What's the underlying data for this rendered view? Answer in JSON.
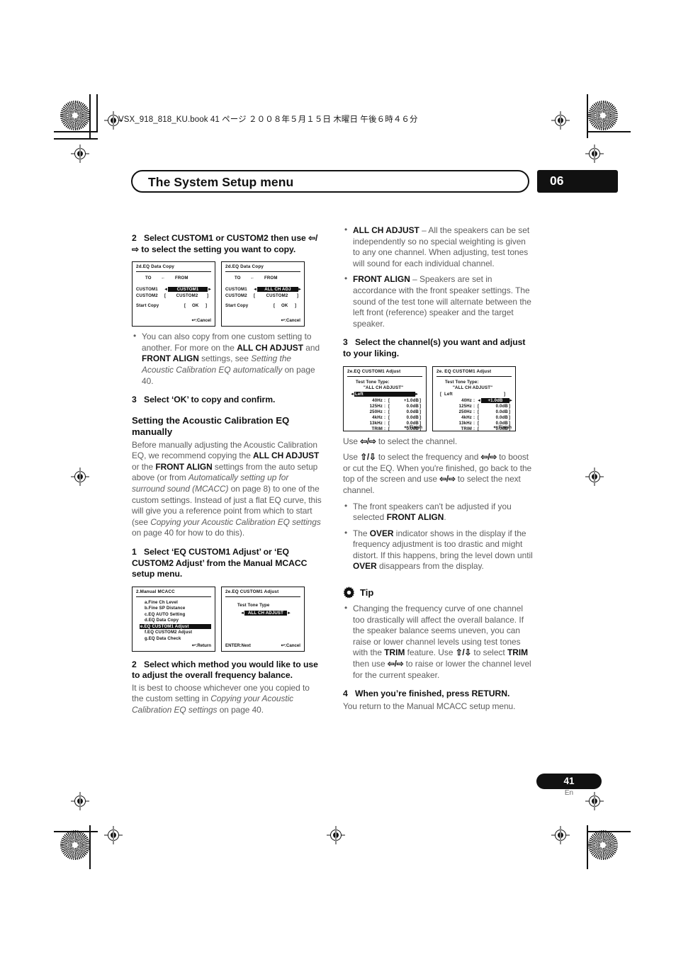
{
  "print": {
    "file_line": "VSX_918_818_KU.book  41 ページ  ２００８年５月１５日  木曜日  午後６時４６分"
  },
  "header": {
    "title": "The System Setup menu",
    "chapter": "06"
  },
  "footer": {
    "page_number": "41",
    "language": "En"
  },
  "left_column": {
    "step2": {
      "num": "2",
      "text_part1": "Select CUSTOM1 or CUSTOM2 then use ",
      "arrows": "⇦/⇨",
      "text_part2": " to select the setting you want to copy."
    },
    "screens": [
      {
        "title": "2d.EQ  Data  Copy",
        "header_to": "TO",
        "header_arrow": "←",
        "header_from": "FROM",
        "row1_label": "CUSTOM1",
        "row1_left_caret": "◄",
        "row1_value": "CUSTOM1",
        "row1_right_caret": "►",
        "row1_highlighted": true,
        "row2_label": "CUSTOM2",
        "row2_open": "[",
        "row2_value": "CUSTOM2",
        "row2_close": "]",
        "start_label": "Start  Copy",
        "start_open": "[",
        "start_value": "OK",
        "start_close": "]",
        "foot": ":Cancel"
      },
      {
        "title": "2d.EQ  Data  Copy",
        "header_to": "TO",
        "header_arrow": "←",
        "header_from": "FROM",
        "row1_label": "CUSTOM1",
        "row1_left_caret": "◄",
        "row1_value": "ALL  CH  ADJ",
        "row1_right_caret": "►",
        "row1_highlighted": true,
        "row2_label": "CUSTOM2",
        "row2_open": "[",
        "row2_value": "CUSTOM2",
        "row2_close": "]",
        "start_label": "Start  Copy",
        "start_open": "[",
        "start_value": "OK",
        "start_close": "]",
        "foot": ":Cancel"
      }
    ],
    "bullet_copy": {
      "p1": "You can also copy from one custom setting to another. For more on the ",
      "b1": "ALL CH ADJUST",
      "p2": " and ",
      "b2": "FRONT ALIGN",
      "p3": " settings, see ",
      "i1": "Setting the Acoustic Calibration EQ automatically",
      "p4": " on page 40."
    },
    "step3": {
      "num": "3",
      "text": "Select ‘OK’ to copy and confirm."
    },
    "heading_manual": "Setting the Acoustic Calibration EQ manually",
    "manual_para": {
      "p1": "Before manually adjusting the Acoustic Calibration EQ, we recommend copying the ",
      "b1": "ALL CH ADJUST",
      "p2": " or the ",
      "b2": "FRONT ALIGN",
      "p3": " settings from the auto setup above (or from ",
      "i1": "Automatically setting up for surround sound (MCACC)",
      "p4": " on page 8) to one of the custom settings. Instead of just a flat EQ curve, this will give you a reference point from which to start (see ",
      "i2": "Copying your Acoustic Calibration EQ settings",
      "p5": " on page 40 for how to do this)."
    },
    "step1": {
      "num": "1",
      "text": "Select ‘EQ CUSTOM1 Adjust’ or ‘EQ CUSTOM2 Adjust’ from the Manual MCACC setup menu."
    },
    "menu_screens": [
      {
        "title": "2.Manual  MCACC",
        "items": [
          "a.Fine  Ch  Level",
          "b.Fine  SP  Distance",
          "c.EQ  AUTO  Setting",
          "d.EQ  Data  Copy",
          "e.EQ  CUSTOM1  Adjust",
          "f.EQ  CUSTOM2  Adjust",
          "g.EQ  Data  Check"
        ],
        "highlighted_index": 4,
        "foot": ":Return"
      },
      {
        "title": "2e.EQ  CUSTOM1  Adjust",
        "subtitle": "Test  Tone  Type",
        "left_caret": "◄",
        "value": "ALL  CH  ADJUST",
        "right_caret": "►",
        "foot_left": "ENTER:Next",
        "foot": ":Cancel"
      }
    ],
    "step2b": {
      "num": "2",
      "text": "Select which method you would like to use to adjust the overall frequency balance.",
      "body_p1": "It is best to choose whichever one you copied to the custom setting in ",
      "body_i1": "Copying your Acoustic Calibration EQ settings",
      "body_p2": " on page 40."
    }
  },
  "right_column": {
    "mode_bullets": [
      {
        "term": "ALL CH ADJUST",
        "dash": " – ",
        "text": "All the speakers can be set independently so no special weighting is given to any one channel. When adjusting, test tones will sound for each individual channel."
      },
      {
        "term": "FRONT ALIGN",
        "dash": " – ",
        "text": "Speakers are set in accordance with the front speaker settings. The sound of the test tone will alternate between the left front (reference) speaker and the target speaker."
      }
    ],
    "step3": {
      "num": "3",
      "text": "Select the channel(s) you want and adjust to your liking."
    },
    "eq_screens": [
      {
        "title": "2e.EQ  CUSTOM1  Adjust",
        "tone_label": "Test  Tone  Type:",
        "tone_value": "\"ALL  CH  ADJUST\"",
        "channel_left_caret": "◄",
        "channel": "Left",
        "channel_right_caret": "►",
        "channel_highlighted": true,
        "rows": [
          {
            "freq": "40Hz",
            "sep": ":",
            "open": "[",
            "value": "+1.0dB",
            "close": "]",
            "highlighted": false
          },
          {
            "freq": "125Hz",
            "sep": ":",
            "open": "[",
            "value": "0.0dB",
            "close": "]",
            "highlighted": false
          },
          {
            "freq": "250Hz",
            "sep": ":",
            "open": "[",
            "value": "0.0dB",
            "close": "]",
            "highlighted": false
          },
          {
            "freq": "4kHz",
            "sep": ":",
            "open": "[",
            "value": "0.0dB",
            "close": "]",
            "highlighted": false
          },
          {
            "freq": "13kHz",
            "sep": ":",
            "open": "[",
            "value": "0.0dB",
            "close": "]",
            "highlighted": false
          },
          {
            "freq": "TRIM",
            "sep": ":",
            "open": "[",
            "value": "0.0dB",
            "close": "]",
            "highlighted": false
          }
        ],
        "foot": ":Finish"
      },
      {
        "title": "2e. EQ  CUSTOM1  Adjust",
        "tone_label": "Test  Tone  Type:",
        "tone_value": "\"ALL  CH  ADJUST\"",
        "channel_open": "[",
        "channel": "Left",
        "channel_close": "]",
        "channel_highlighted": false,
        "rows": [
          {
            "freq": "40Hz",
            "sep": ":",
            "left_caret": "◄",
            "value": "+1.0dB",
            "right_caret": "►",
            "highlighted": true
          },
          {
            "freq": "125Hz",
            "sep": ":",
            "open": "[",
            "value": "0.0dB",
            "close": "]",
            "highlighted": false
          },
          {
            "freq": "250Hz",
            "sep": ":",
            "open": "[",
            "value": "0.0dB",
            "close": "]",
            "highlighted": false
          },
          {
            "freq": "4kHz",
            "sep": ":",
            "open": "[",
            "value": "0.0dB",
            "close": "]",
            "highlighted": false
          },
          {
            "freq": "13kHz",
            "sep": ":",
            "open": "[",
            "value": "0.0dB",
            "close": "]",
            "highlighted": false
          },
          {
            "freq": "TRIM",
            "sep": ":",
            "open": "[",
            "value": "0.0dB",
            "close": "]",
            "highlighted": false
          }
        ],
        "foot": ":Finish"
      }
    ],
    "use_para1_a": "Use ",
    "use_para1_arrows": "⇦/⇨",
    "use_para1_b": " to select the channel.",
    "use_para2_a": "Use ",
    "use_para2_arrows1": "⇧/⇩",
    "use_para2_b": " to select the frequency and ",
    "use_para2_arrows2": "⇦/⇨",
    "use_para2_c": " to boost or cut the EQ. When you're finished, go back to the top of the screen and use ",
    "use_para2_arrows3": "⇦/⇨",
    "use_para2_d": " to select the next channel.",
    "notes": [
      {
        "p1": "The front speakers can't be adjusted if you selected ",
        "b1": "FRONT ALIGN",
        "p2": "."
      }
    ],
    "over_note": {
      "p1": "The ",
      "b1": "OVER",
      "p2": " indicator shows in the display if the frequency adjustment is too drastic and might distort. If this happens, bring the level down until ",
      "b2": "OVER",
      "p3": " disappears from the display."
    },
    "tip": {
      "label": "Tip",
      "icon": "gear-icon",
      "body_p1": "Changing the frequency curve of one channel too drastically will affect the overall balance. If the speaker balance seems uneven, you can raise or lower channel levels using test tones with the ",
      "body_b1": "TRIM",
      "body_p2": " feature. Use ",
      "body_arrows1": "⇧/⇩",
      "body_p3": " to select ",
      "body_b2": "TRIM",
      "body_p4": " then use ",
      "body_arrows2": "⇦/⇨",
      "body_p5": " to raise or lower the channel level for the current speaker."
    },
    "step4": {
      "num": "4",
      "text": "When you’re finished, press RETURN.",
      "body": "You return to the Manual MCACC setup menu."
    }
  }
}
